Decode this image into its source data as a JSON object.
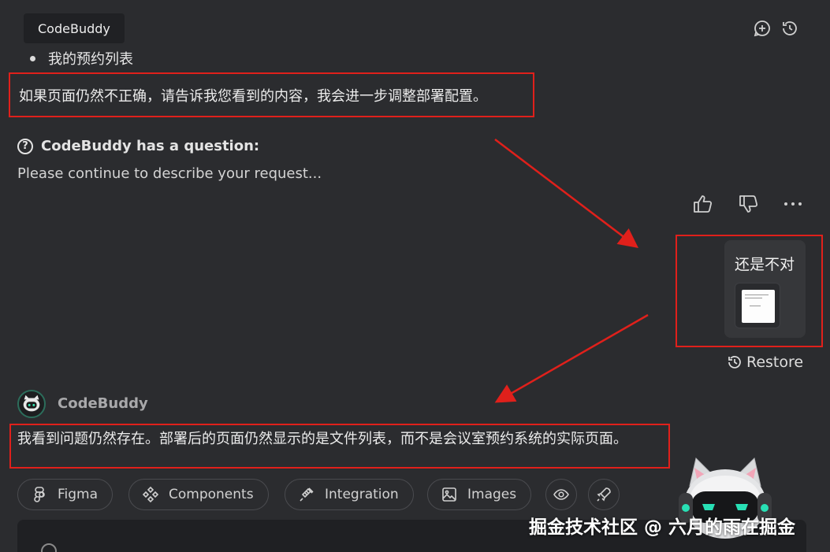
{
  "header": {
    "app_name": "CodeBuddy",
    "icons": [
      "new-chat-icon",
      "history-icon"
    ]
  },
  "conversation": {
    "bullet_item": "我的预约列表",
    "assistant_note": "如果页面仍然不正确，请告诉我您看到的内容，我会进一步调整部署配置。",
    "question": {
      "title": "CodeBuddy has a question:",
      "body": "Please continue to describe your request..."
    },
    "user_message": {
      "text": "还是不对",
      "restore_label": "Restore"
    },
    "bot": {
      "name": "CodeBuddy",
      "reply": "我看到问题仍然存在。部署后的页面仍然显示的是文件列表，而不是会议室预约系统的实际页面。"
    }
  },
  "chips": [
    {
      "label": "Figma",
      "icon": "figma-icon"
    },
    {
      "label": "Components",
      "icon": "components-icon"
    },
    {
      "label": "Integration",
      "icon": "plug-icon"
    },
    {
      "label": "Images",
      "icon": "image-icon"
    }
  ],
  "watermark": "掘金技术社区 @ 六月的雨在掘金",
  "colors": {
    "background": "#2b2c2f",
    "annotation_red": "#e0201b",
    "composer": "#1f2023"
  }
}
